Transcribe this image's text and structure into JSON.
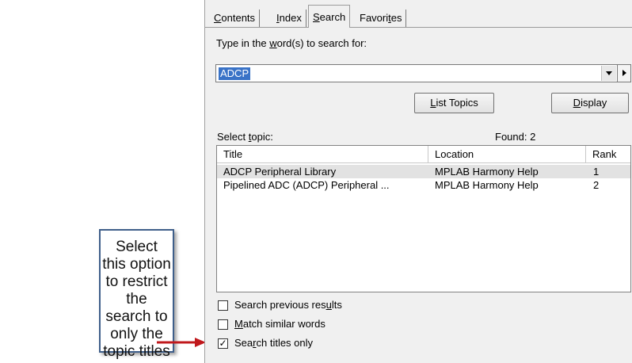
{
  "tabs": [
    {
      "label": "Contents",
      "accel": "C",
      "rest": "ontents"
    },
    {
      "label": "Index",
      "accel": "I",
      "rest": "ndex"
    },
    {
      "label": "Search",
      "pre": "",
      "accel": "S",
      "rest": "earch"
    },
    {
      "label": "Favorites",
      "pre": "Favori",
      "accel": "t",
      "rest": "es"
    }
  ],
  "search": {
    "prompt_pre": "Type in the ",
    "prompt_accel": "w",
    "prompt_post": "ord(s) to search for:",
    "value": "ADCP"
  },
  "buttons": {
    "list_topics_accel": "L",
    "list_topics_rest": "ist Topics",
    "display_accel": "D",
    "display_rest": "isplay"
  },
  "results": {
    "label_pre": "Select ",
    "label_accel": "t",
    "label_post": "opic:",
    "found": "Found: 2",
    "columns": {
      "title": "Title",
      "location": "Location",
      "rank": "Rank"
    },
    "rows": [
      {
        "title": "ADCP Peripheral Library",
        "location": "MPLAB Harmony Help",
        "rank": "1"
      },
      {
        "title": "Pipelined ADC (ADCP) Peripheral ...",
        "location": "MPLAB Harmony Help",
        "rank": "2"
      }
    ]
  },
  "options": [
    {
      "pre": "Search previous res",
      "accel": "u",
      "post": "lts",
      "checked": false
    },
    {
      "pre": "",
      "accel": "M",
      "post": "atch similar words",
      "checked": false
    },
    {
      "pre": "Sea",
      "accel": "r",
      "post": "ch titles only",
      "checked": true
    }
  ],
  "callout": {
    "text": "Select this option to restrict the search to only the topic titles"
  },
  "colors": {
    "selection": "#3a73c7",
    "arrow": "#c0181c",
    "callout_border": "#3f5f8a"
  }
}
